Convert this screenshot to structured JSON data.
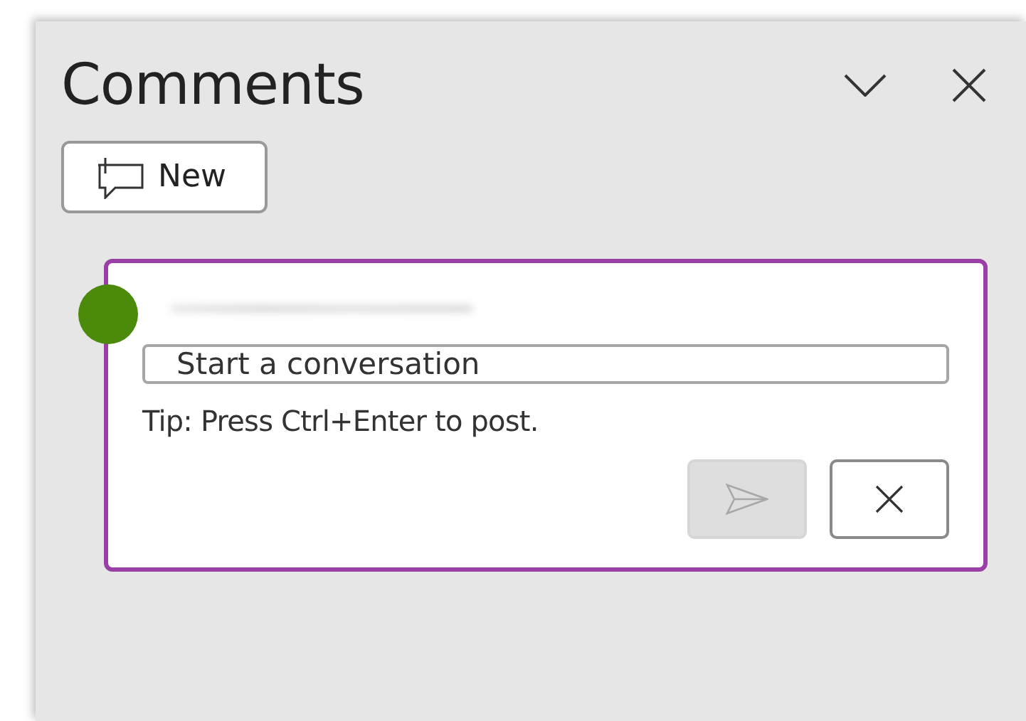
{
  "panel": {
    "title": "Comments",
    "new_button": "New"
  },
  "composer": {
    "placeholder": "Start a conversation",
    "tip": "Tip: Press Ctrl+Enter to post.",
    "send_disabled": true
  }
}
